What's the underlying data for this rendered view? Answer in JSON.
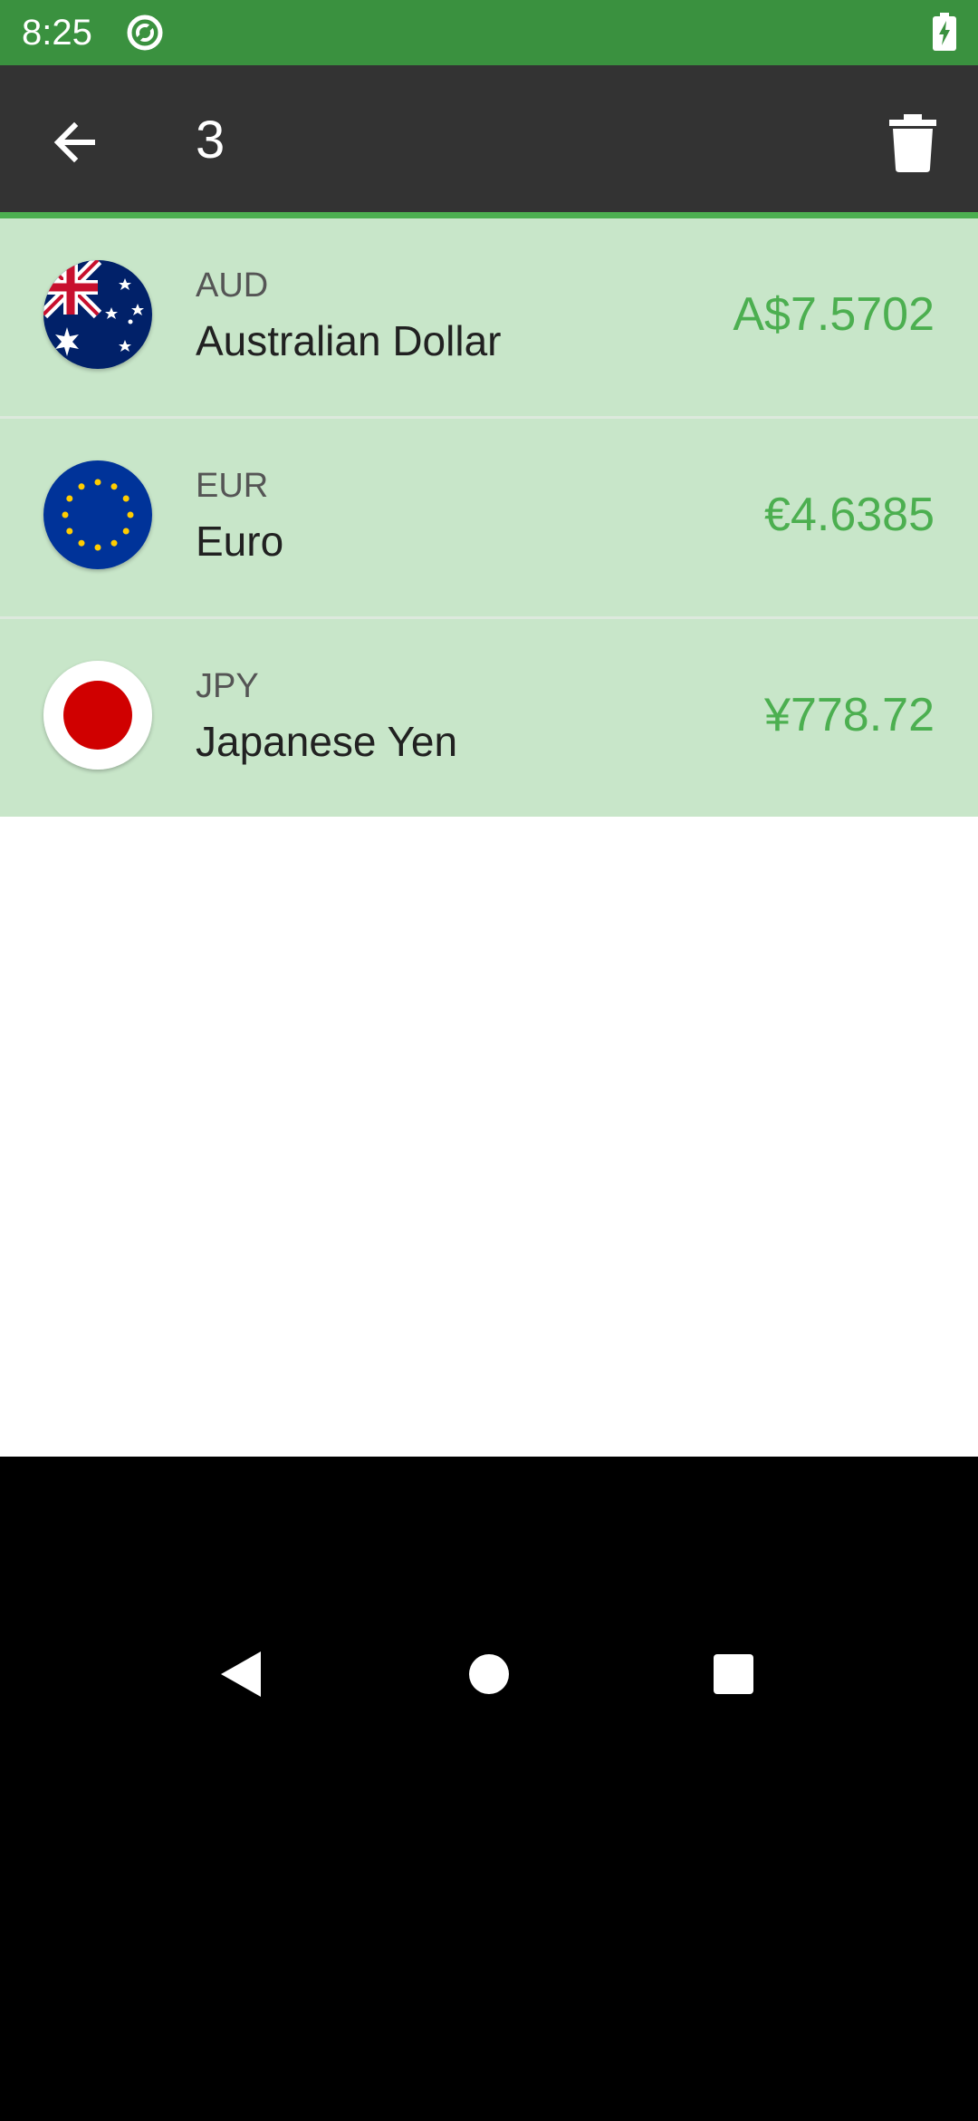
{
  "status_bar": {
    "time": "8:25",
    "icons": [
      "sync-icon",
      "battery-charging-icon"
    ]
  },
  "app_bar": {
    "title": "3",
    "back_icon": "arrow-back-icon",
    "delete_icon": "trash-icon"
  },
  "currencies": [
    {
      "code": "AUD",
      "name": "Australian Dollar",
      "amount": "A$7.5702",
      "flag": "australia-flag"
    },
    {
      "code": "EUR",
      "name": "Euro",
      "amount": "€4.6385",
      "flag": "eu-flag"
    },
    {
      "code": "JPY",
      "name": "Japanese Yen",
      "amount": "¥778.72",
      "flag": "japan-flag"
    }
  ],
  "fab": {
    "icon": "globe-icon"
  },
  "nav_bar": {
    "icons": [
      "nav-back-icon",
      "nav-home-icon",
      "nav-recents-icon"
    ]
  },
  "colors": {
    "status_bar": "#3a913f",
    "app_bar": "#333333",
    "accent": "#4caf50",
    "row_background": "#c8e6c9",
    "amount_text": "#4caf50"
  }
}
